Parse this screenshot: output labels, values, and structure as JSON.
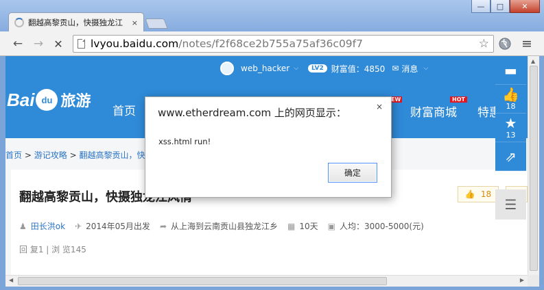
{
  "window": {
    "minimize_label": "—",
    "maximize_label": "□",
    "close_label": "✕"
  },
  "tab": {
    "title": "翻越高黎贡山，快摄独龙江",
    "close_label": "×"
  },
  "toolbar": {
    "back_glyph": "←",
    "forward_glyph": "→",
    "stop_glyph": "✕",
    "url_host": "lvyou.baidu.com",
    "url_path": "/notes/f2f68ce2b755a75af36c09f7",
    "bookmark_glyph": "☆",
    "menu_glyph": "≡"
  },
  "userbar": {
    "username": "web_hacker",
    "caret": "⌵",
    "level": "LV2",
    "wealth": "财富值：4850",
    "mail_icon": "✉",
    "messages": "消息",
    "messages_caret": "⌵"
  },
  "site": {
    "logo_bai": "Bai",
    "logo_du": "du",
    "logo_cn": "旅游",
    "nav_home": "首页",
    "nav_shop": "财富商城",
    "nav_te": "特惠",
    "badge_hot": "HOT",
    "badge_new": "EW"
  },
  "breadcrumb": {
    "home": "首页",
    "sep1": ">",
    "guides": "游记攻略",
    "sep2": ">",
    "current": "翻越高黎贡山，快摄"
  },
  "note": {
    "title": "翻越高黎贡山，快摄独龙江风情",
    "likes": "18",
    "author": "田长洪ok",
    "depart": "2014年05月出发",
    "route": "从上海到云南贡山县独龙江乡",
    "days": "10天",
    "cost": "人均：3000-5000(元)",
    "stats": "回 复1 | 浏 览145"
  },
  "side_tools": {
    "like_count": "18",
    "fav_count": "13"
  },
  "dialog": {
    "title": "www.etherdream.com 上的网页显示：",
    "message": "xss.html run!",
    "ok_label": "确定",
    "close_label": "×"
  }
}
